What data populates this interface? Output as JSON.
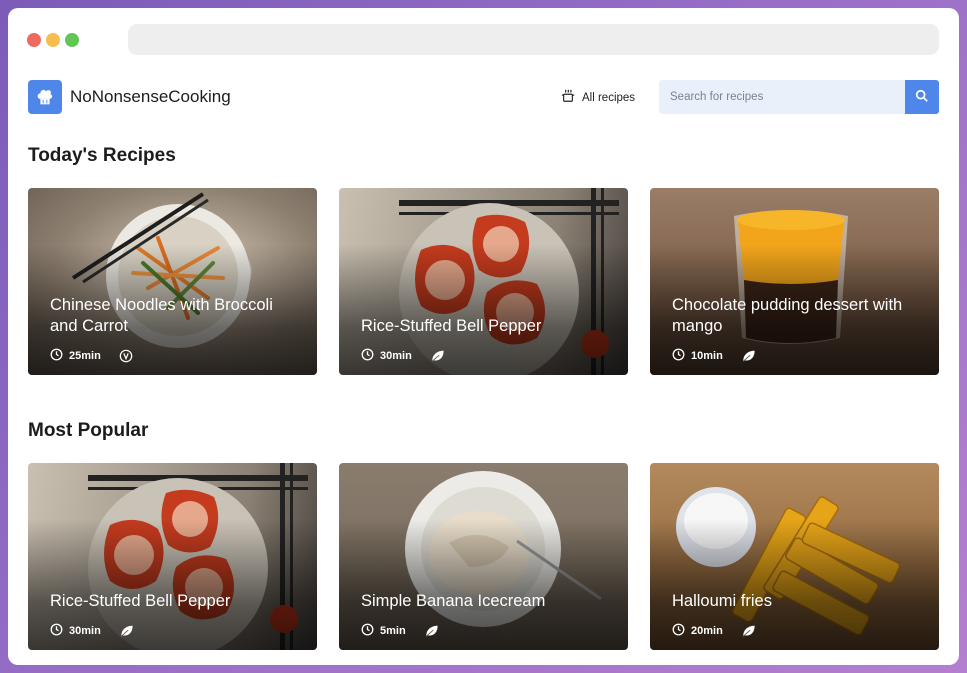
{
  "app": {
    "name": "NoNonsenseCooking"
  },
  "nav": {
    "all_recipes": "All recipes"
  },
  "search": {
    "placeholder": "Search for recipes"
  },
  "sections": {
    "today": {
      "title": "Today's Recipes",
      "cards": [
        {
          "title": "Chinese Noodles with Broccoli and Carrot",
          "time": "25min",
          "diet_icon": "vegan-v-icon"
        },
        {
          "title": "Rice-Stuffed Bell Pepper",
          "time": "30min",
          "diet_icon": "leaf-icon"
        },
        {
          "title": "Chocolate pudding dessert with mango",
          "time": "10min",
          "diet_icon": "leaf-icon"
        }
      ]
    },
    "popular": {
      "title": "Most Popular",
      "cards": [
        {
          "title": "Rice-Stuffed Bell Pepper",
          "time": "30min",
          "diet_icon": "leaf-icon"
        },
        {
          "title": "Simple Banana Icecream",
          "time": "5min",
          "diet_icon": "leaf-icon"
        },
        {
          "title": "Halloumi fries",
          "time": "20min",
          "diet_icon": "leaf-icon"
        }
      ]
    }
  },
  "colors": {
    "accent": "#4f86ea",
    "search_bg": "#eaf0fa"
  }
}
